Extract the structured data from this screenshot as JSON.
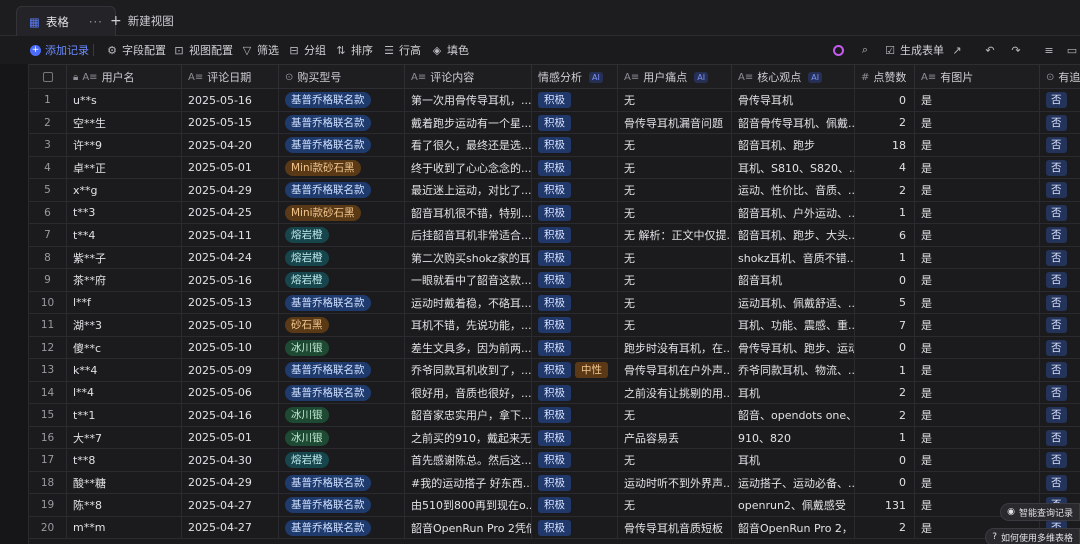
{
  "tabs": {
    "active_label": "表格",
    "more": "···",
    "new_view_label": "新建视图"
  },
  "toolbar": {
    "add_record": "添加记录",
    "field_config": "字段配置",
    "view_config": "视图配置",
    "filter": "筛选",
    "group": "分组",
    "sort": "排序",
    "row_height": "行高",
    "fill_color": "填色",
    "generate_form": "生成表单"
  },
  "columns": {
    "username": "用户名",
    "date": "评论日期",
    "model": "购买型号",
    "content": "评论内容",
    "sentiment": "情感分析",
    "pain": "用户痛点",
    "core": "核心观点",
    "likes": "点赞数",
    "has_image": "有图片",
    "followup": "有追评"
  },
  "ai_badge": "AI",
  "rows": [
    {
      "n": "1",
      "user": "u**s",
      "date": "2025-05-16",
      "model": "基普乔格联名款",
      "mc": "blue",
      "content": "第一次用骨传导耳机，...",
      "sent": "积极",
      "sent2": "",
      "pain": "无",
      "core": "骨传导耳机",
      "likes": "0",
      "img": "是",
      "follow": "否"
    },
    {
      "n": "2",
      "user": "空**生",
      "date": "2025-05-15",
      "model": "基普乔格联名款",
      "mc": "blue",
      "content": "戴着跑步运动有一个星...",
      "sent": "积极",
      "sent2": "",
      "pain": "骨传导耳机漏音问题",
      "core": "韶音骨传导耳机、佩戴...",
      "likes": "2",
      "img": "是",
      "follow": "否"
    },
    {
      "n": "3",
      "user": "许**9",
      "date": "2025-04-20",
      "model": "基普乔格联名款",
      "mc": "blue",
      "content": "看了很久，最终还是选...",
      "sent": "积极",
      "sent2": "",
      "pain": "无",
      "core": "韶音耳机、跑步",
      "likes": "18",
      "img": "是",
      "follow": "否"
    },
    {
      "n": "4",
      "user": "卓**正",
      "date": "2025-05-01",
      "model": "Mini款砂石黑",
      "mc": "orange",
      "content": "终于收到了心心念念的...",
      "sent": "积极",
      "sent2": "",
      "pain": "无",
      "core": "耳机、S810、S820、...",
      "likes": "4",
      "img": "是",
      "follow": "否"
    },
    {
      "n": "5",
      "user": "x**g",
      "date": "2025-04-29",
      "model": "基普乔格联名款",
      "mc": "blue",
      "content": "最近迷上运动，对比了...",
      "sent": "积极",
      "sent2": "",
      "pain": "无",
      "core": "运动、性价比、音质、...",
      "likes": "2",
      "img": "是",
      "follow": "否"
    },
    {
      "n": "6",
      "user": "t**3",
      "date": "2025-04-25",
      "model": "Mini款砂石黑",
      "mc": "orange",
      "content": "韶音耳机很不错，特别...",
      "sent": "积极",
      "sent2": "",
      "pain": "无",
      "core": "韶音耳机、户外运动、...",
      "likes": "1",
      "img": "是",
      "follow": "否"
    },
    {
      "n": "7",
      "user": "t**4",
      "date": "2025-04-11",
      "model": "熔岩橙",
      "mc": "teal",
      "content": "后挂韶音耳机非常适合...",
      "sent": "积极",
      "sent2": "",
      "pain": "无 解析：正文中仅提...",
      "core": "韶音耳机、跑步、大头...",
      "likes": "6",
      "img": "是",
      "follow": "否"
    },
    {
      "n": "8",
      "user": "紫**子",
      "date": "2025-04-24",
      "model": "熔岩橙",
      "mc": "teal",
      "content": "第二次购买shokz家的耳...",
      "sent": "积极",
      "sent2": "",
      "pain": "无",
      "core": "shokz耳机、音质不错...",
      "likes": "1",
      "img": "是",
      "follow": "否"
    },
    {
      "n": "9",
      "user": "茶**府",
      "date": "2025-05-16",
      "model": "熔岩橙",
      "mc": "teal",
      "content": "一眼就看中了韶音这款...",
      "sent": "积极",
      "sent2": "",
      "pain": "无",
      "core": "韶音耳机",
      "likes": "0",
      "img": "是",
      "follow": "否"
    },
    {
      "n": "10",
      "user": "l**f",
      "date": "2025-05-13",
      "model": "基普乔格联名款",
      "mc": "blue",
      "content": "运动时戴着稳，不硌耳...",
      "sent": "积极",
      "sent2": "",
      "pain": "无",
      "core": "运动耳机、佩戴舒适、...",
      "likes": "5",
      "img": "是",
      "follow": "否"
    },
    {
      "n": "11",
      "user": "湖**3",
      "date": "2025-05-10",
      "model": "砂石黑",
      "mc": "orange",
      "content": "耳机不错，先说功能，...",
      "sent": "积极",
      "sent2": "",
      "pain": "无",
      "core": "耳机、功能、震感、重...",
      "likes": "7",
      "img": "是",
      "follow": "否"
    },
    {
      "n": "12",
      "user": "傻**c",
      "date": "2025-05-10",
      "model": "冰川银",
      "mc": "green",
      "content": "差生文具多，因为前两...",
      "sent": "积极",
      "sent2": "",
      "pain": "跑步时没有耳机，在...",
      "core": "骨传导耳机、跑步、运动",
      "likes": "0",
      "img": "是",
      "follow": "否"
    },
    {
      "n": "13",
      "user": "k**4",
      "date": "2025-05-09",
      "model": "基普乔格联名款",
      "mc": "blue",
      "content": "乔爷同款耳机收到了，...",
      "sent": "积极",
      "sent2": "中性",
      "pain": "骨传导耳机在户外声...",
      "core": "乔爷同款耳机、物流、...",
      "likes": "1",
      "img": "是",
      "follow": "否"
    },
    {
      "n": "14",
      "user": "l**4",
      "date": "2025-05-06",
      "model": "基普乔格联名款",
      "mc": "blue",
      "content": "很好用，音质也很好，...",
      "sent": "积极",
      "sent2": "",
      "pain": "之前没有让挑剔的用...",
      "core": "耳机",
      "likes": "2",
      "img": "是",
      "follow": "否"
    },
    {
      "n": "15",
      "user": "t**1",
      "date": "2025-04-16",
      "model": "冰川银",
      "mc": "green",
      "content": "韶音家忠实用户，拿下...",
      "sent": "积极",
      "sent2": "",
      "pain": "无",
      "core": "韶音、opendots one、...",
      "likes": "2",
      "img": "是",
      "follow": "否"
    },
    {
      "n": "16",
      "user": "大**7",
      "date": "2025-05-01",
      "model": "冰川银",
      "mc": "green",
      "content": "之前买的910，戴起来无...",
      "sent": "积极",
      "sent2": "",
      "pain": "产品容易丢",
      "core": "910、820",
      "likes": "1",
      "img": "是",
      "follow": "否"
    },
    {
      "n": "17",
      "user": "t**8",
      "date": "2025-04-30",
      "model": "熔岩橙",
      "mc": "teal",
      "content": "首先感谢陈总。然后这...",
      "sent": "积极",
      "sent2": "",
      "pain": "无",
      "core": "耳机",
      "likes": "0",
      "img": "是",
      "follow": "否"
    },
    {
      "n": "18",
      "user": "酸**糖",
      "date": "2025-04-29",
      "model": "基普乔格联名款",
      "mc": "blue",
      "content": "#我的运动搭子 好东西...",
      "sent": "积极",
      "sent2": "",
      "pain": "运动时听不到外界声...",
      "core": "运动搭子、运动必备、...",
      "likes": "0",
      "img": "是",
      "follow": "否"
    },
    {
      "n": "19",
      "user": "陈**8",
      "date": "2025-04-27",
      "model": "基普乔格联名款",
      "mc": "blue",
      "content": "由510到800再到现在o...",
      "sent": "积极",
      "sent2": "",
      "pain": "无",
      "core": "openrun2、佩戴感受",
      "likes": "131",
      "img": "是",
      "follow": "否"
    },
    {
      "n": "20",
      "user": "m**m",
      "date": "2025-04-27",
      "model": "基普乔格联名款",
      "mc": "blue",
      "content": "韶音OpenRun Pro 2凭借...",
      "sent": "积极",
      "sent2": "",
      "pain": "骨传导耳机音质短板",
      "core": "韶音OpenRun Pro 2，...",
      "likes": "2",
      "img": "是",
      "follow": "否"
    }
  ],
  "floating": {
    "smart_query": "智能查询记录",
    "how_to_use": "如何使用多维表格"
  }
}
